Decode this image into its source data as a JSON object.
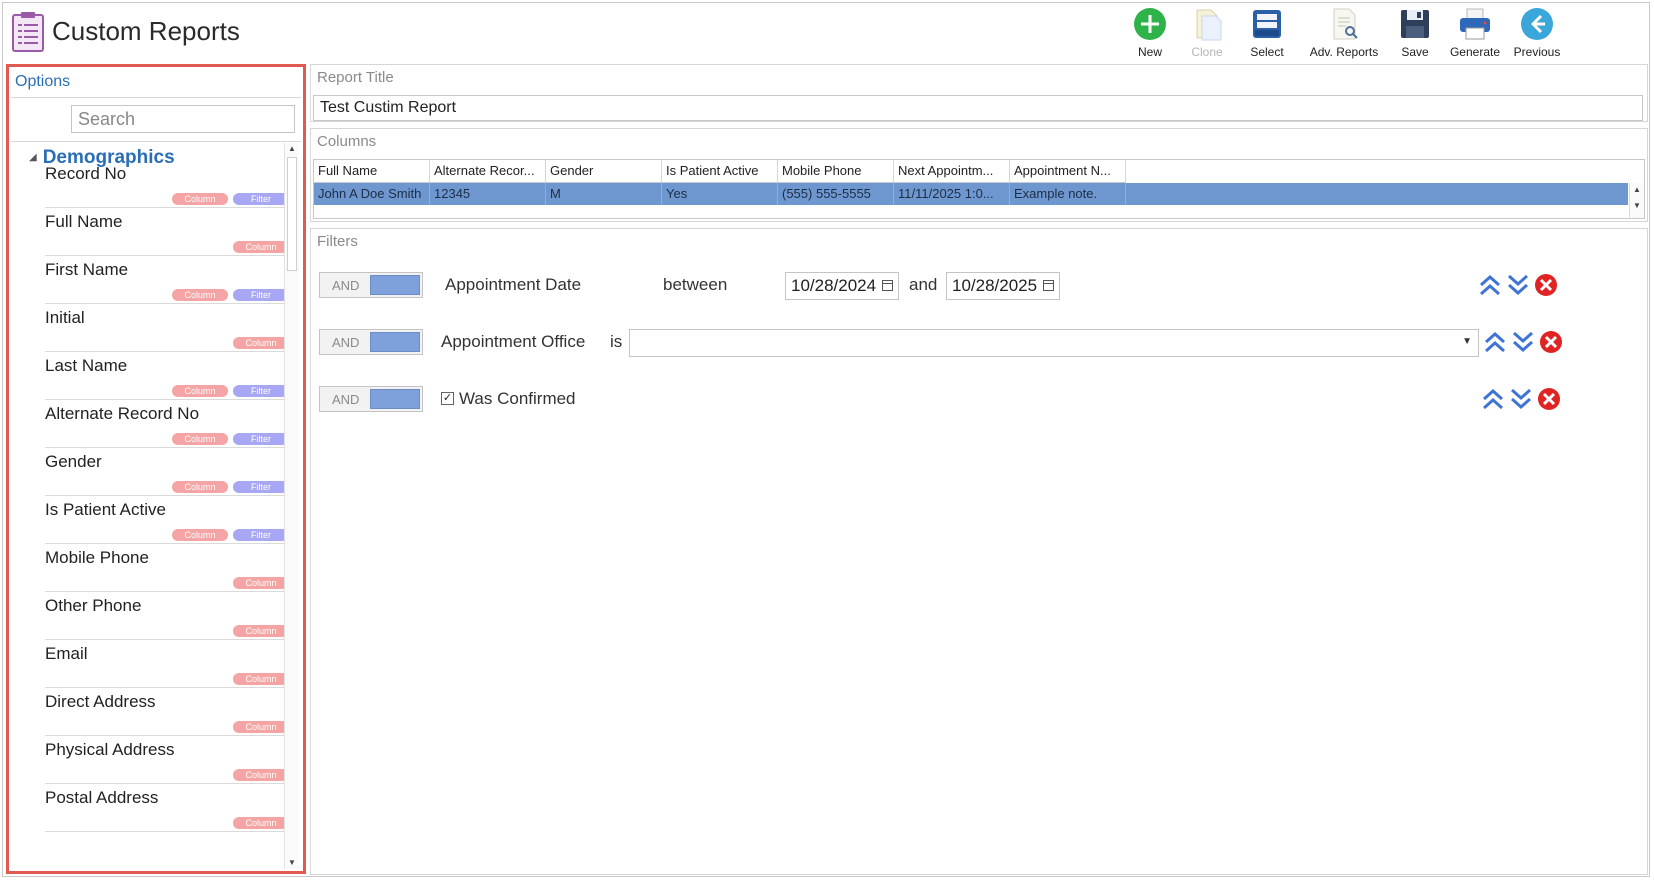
{
  "app": {
    "title": "Custom Reports"
  },
  "toolbar": {
    "new": "New",
    "clone": "Clone",
    "select": "Select",
    "adv_reports": "Adv. Reports",
    "save": "Save",
    "generate": "Generate",
    "previous": "Previous"
  },
  "options": {
    "header": "Options",
    "search_placeholder": "Search",
    "group": "Demographics",
    "chip_column": "Column",
    "chip_filter": "Filter",
    "fields": [
      {
        "name": "Record No",
        "filter": true
      },
      {
        "name": "Full Name",
        "filter": false
      },
      {
        "name": "First Name",
        "filter": true
      },
      {
        "name": "Initial",
        "filter": false
      },
      {
        "name": "Last Name",
        "filter": true
      },
      {
        "name": "Alternate Record No",
        "filter": true
      },
      {
        "name": "Gender",
        "filter": true
      },
      {
        "name": "Is Patient Active",
        "filter": true
      },
      {
        "name": "Mobile Phone",
        "filter": false
      },
      {
        "name": "Other Phone",
        "filter": false
      },
      {
        "name": "Email",
        "filter": false
      },
      {
        "name": "Direct Address",
        "filter": false
      },
      {
        "name": "Physical Address",
        "filter": false
      },
      {
        "name": "Postal Address",
        "filter": false
      }
    ]
  },
  "report": {
    "title_label": "Report Title",
    "title_value": "Test Custim Report",
    "columns_label": "Columns",
    "columns": [
      "Full Name",
      "Alternate Recor...",
      "Gender",
      "Is Patient Active",
      "Mobile Phone",
      "Next Appointm...",
      "Appointment N..."
    ],
    "row": [
      "John A Doe Smith",
      "12345",
      "M",
      "Yes",
      "(555) 555-5555",
      "11/11/2025 1:0...",
      "Example note."
    ],
    "filters_label": "Filters",
    "filters": {
      "operator": "AND",
      "f1": {
        "field": "Appointment Date",
        "op": "between",
        "from": "10/28/2024",
        "and": "and",
        "to": "10/28/2025"
      },
      "f2": {
        "field": "Appointment Office",
        "op": "is",
        "value": ""
      },
      "f3": {
        "field": "Was Confirmed",
        "checked": "✓"
      }
    }
  },
  "colors": {
    "accent": "#2a6fb5",
    "selected_row": "#6f97cf",
    "highlight_border": "#e05a50",
    "chip_column": "#f4a4a4",
    "chip_filter": "#a7a7f3"
  }
}
